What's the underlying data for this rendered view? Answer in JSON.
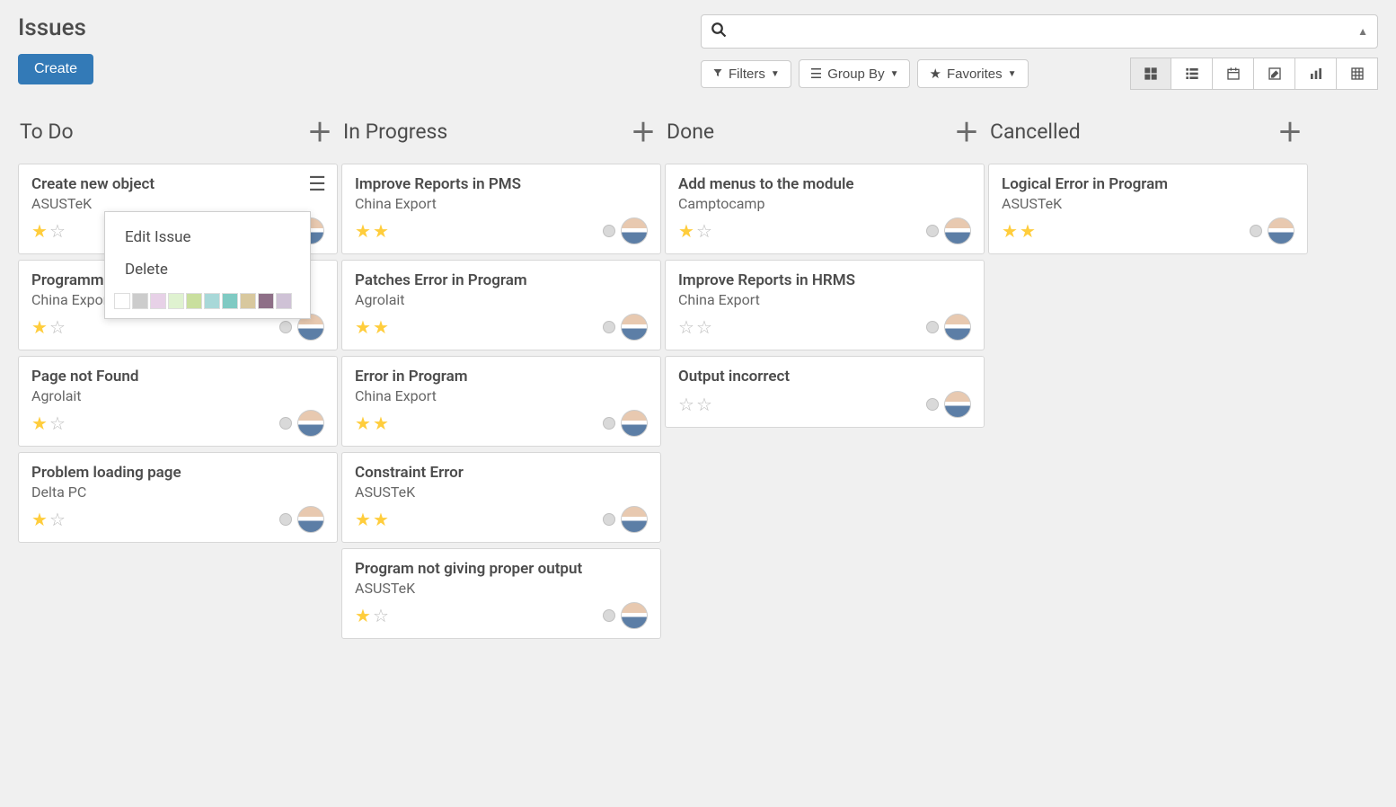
{
  "page_title": "Issues",
  "create_label": "Create",
  "search": {
    "placeholder": ""
  },
  "filters_label": "Filters",
  "groupby_label": "Group By",
  "favorites_label": "Favorites",
  "ctx_menu": {
    "edit": "Edit Issue",
    "delete": "Delete"
  },
  "ctx_colors": [
    "#ffffff",
    "#cccccc",
    "#e7d1e7",
    "#dff2d0",
    "#c9df9e",
    "#a8d8d8",
    "#7fcac3",
    "#d8c89e",
    "#8e6f87",
    "#cfc2d6"
  ],
  "columns": [
    {
      "title": "To Do",
      "cards": [
        {
          "title": "Create new object",
          "company": "ASUSTeK",
          "stars": 1,
          "has_menu": true,
          "show_ctx": true
        },
        {
          "title": "Programming Error",
          "company": "China Export",
          "stars": 1
        },
        {
          "title": "Page not Found",
          "company": "Agrolait",
          "stars": 1
        },
        {
          "title": "Problem loading page",
          "company": "Delta PC",
          "stars": 1
        }
      ]
    },
    {
      "title": "In Progress",
      "cards": [
        {
          "title": "Improve Reports in PMS",
          "company": "China Export",
          "stars": 2
        },
        {
          "title": "Patches Error in Program",
          "company": "Agrolait",
          "stars": 2
        },
        {
          "title": "Error in Program",
          "company": "China Export",
          "stars": 2
        },
        {
          "title": "Constraint Error",
          "company": "ASUSTeK",
          "stars": 2
        },
        {
          "title": "Program not giving proper output",
          "company": "ASUSTeK",
          "stars": 1
        }
      ]
    },
    {
      "title": "Done",
      "cards": [
        {
          "title": "Add menus to the module",
          "company": "Camptocamp",
          "stars": 1
        },
        {
          "title": "Improve Reports in HRMS",
          "company": "China Export",
          "stars": 0
        },
        {
          "title": "Output incorrect",
          "company": "",
          "stars": 0
        }
      ]
    },
    {
      "title": "Cancelled",
      "cards": [
        {
          "title": "Logical Error in Program",
          "company": "ASUSTeK",
          "stars": 2
        }
      ]
    }
  ]
}
